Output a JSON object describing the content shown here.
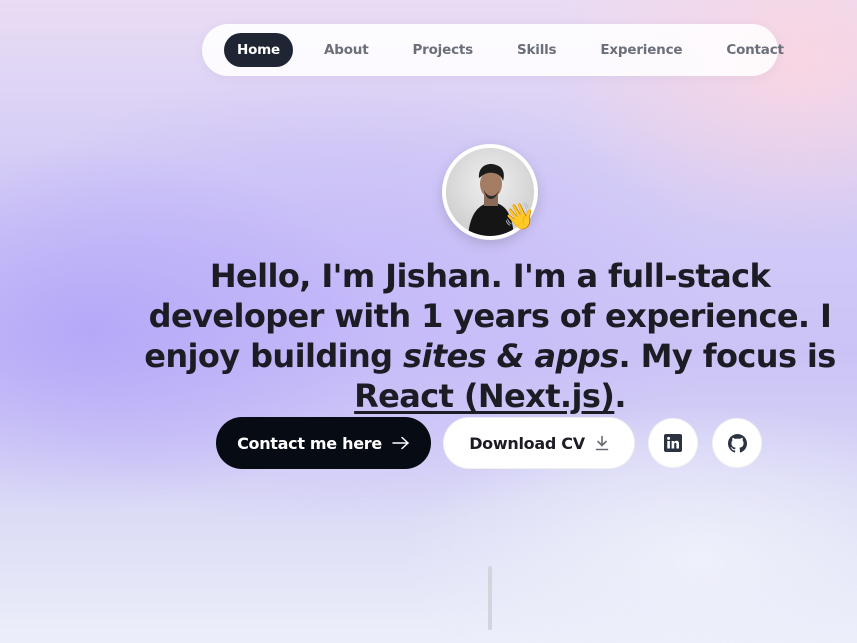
{
  "nav": {
    "items": [
      {
        "label": "Home",
        "active": true
      },
      {
        "label": "About",
        "active": false
      },
      {
        "label": "Projects",
        "active": false
      },
      {
        "label": "Skills",
        "active": false
      },
      {
        "label": "Experience",
        "active": false
      },
      {
        "label": "Contact",
        "active": false
      }
    ]
  },
  "hero": {
    "avatar_icon": "profile-photo",
    "wave_emoji": "👋",
    "headline_part1": "Hello, I'm Jishan. I'm a full-stack developer with 1 years of experience. I enjoy building ",
    "headline_italic": "sites & apps",
    "headline_part2": ". My focus is ",
    "headline_underline": "React (Next.js)",
    "headline_end": "."
  },
  "actions": {
    "contact_label": "Contact me here",
    "contact_icon": "arrow-right-icon",
    "cv_label": "Download CV",
    "cv_icon": "download-icon",
    "linkedin_icon": "linkedin-icon",
    "github_icon": "github-icon"
  },
  "colors": {
    "nav_active_bg": "#1f2533",
    "primary_button": "#070b14",
    "text": "#1c1c24"
  }
}
